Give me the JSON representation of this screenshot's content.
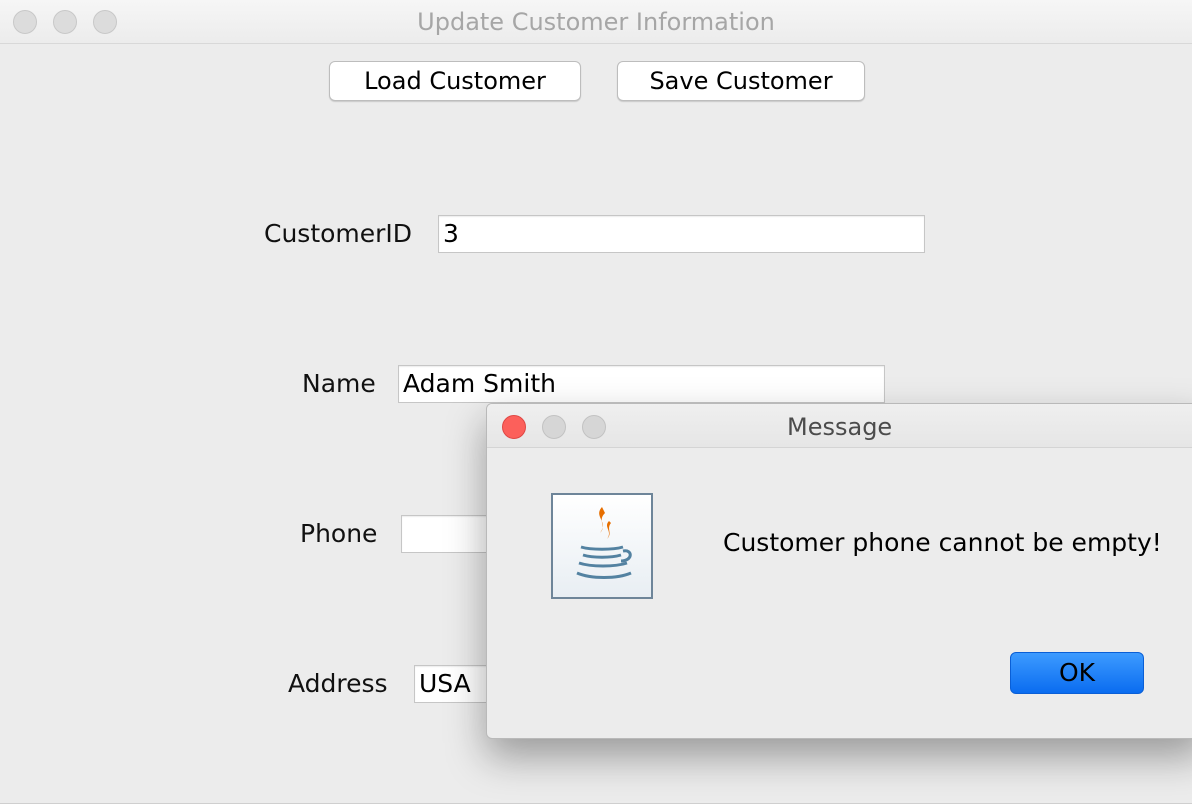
{
  "window": {
    "title": "Update Customer Information",
    "load_button": "Load Customer",
    "save_button": "Save Customer"
  },
  "form": {
    "customer_id": {
      "label": "CustomerID",
      "value": "3"
    },
    "name": {
      "label": "Name",
      "value": "Adam Smith"
    },
    "phone": {
      "label": "Phone",
      "value": ""
    },
    "address": {
      "label": "Address",
      "value": "USA"
    }
  },
  "dialog": {
    "title": "Message",
    "icon": "java-cup-icon",
    "message": "Customer phone cannot be empty!",
    "ok_button": "OK"
  },
  "colors": {
    "close": "#fc605b",
    "ok_accent": "#1a7cf4"
  }
}
